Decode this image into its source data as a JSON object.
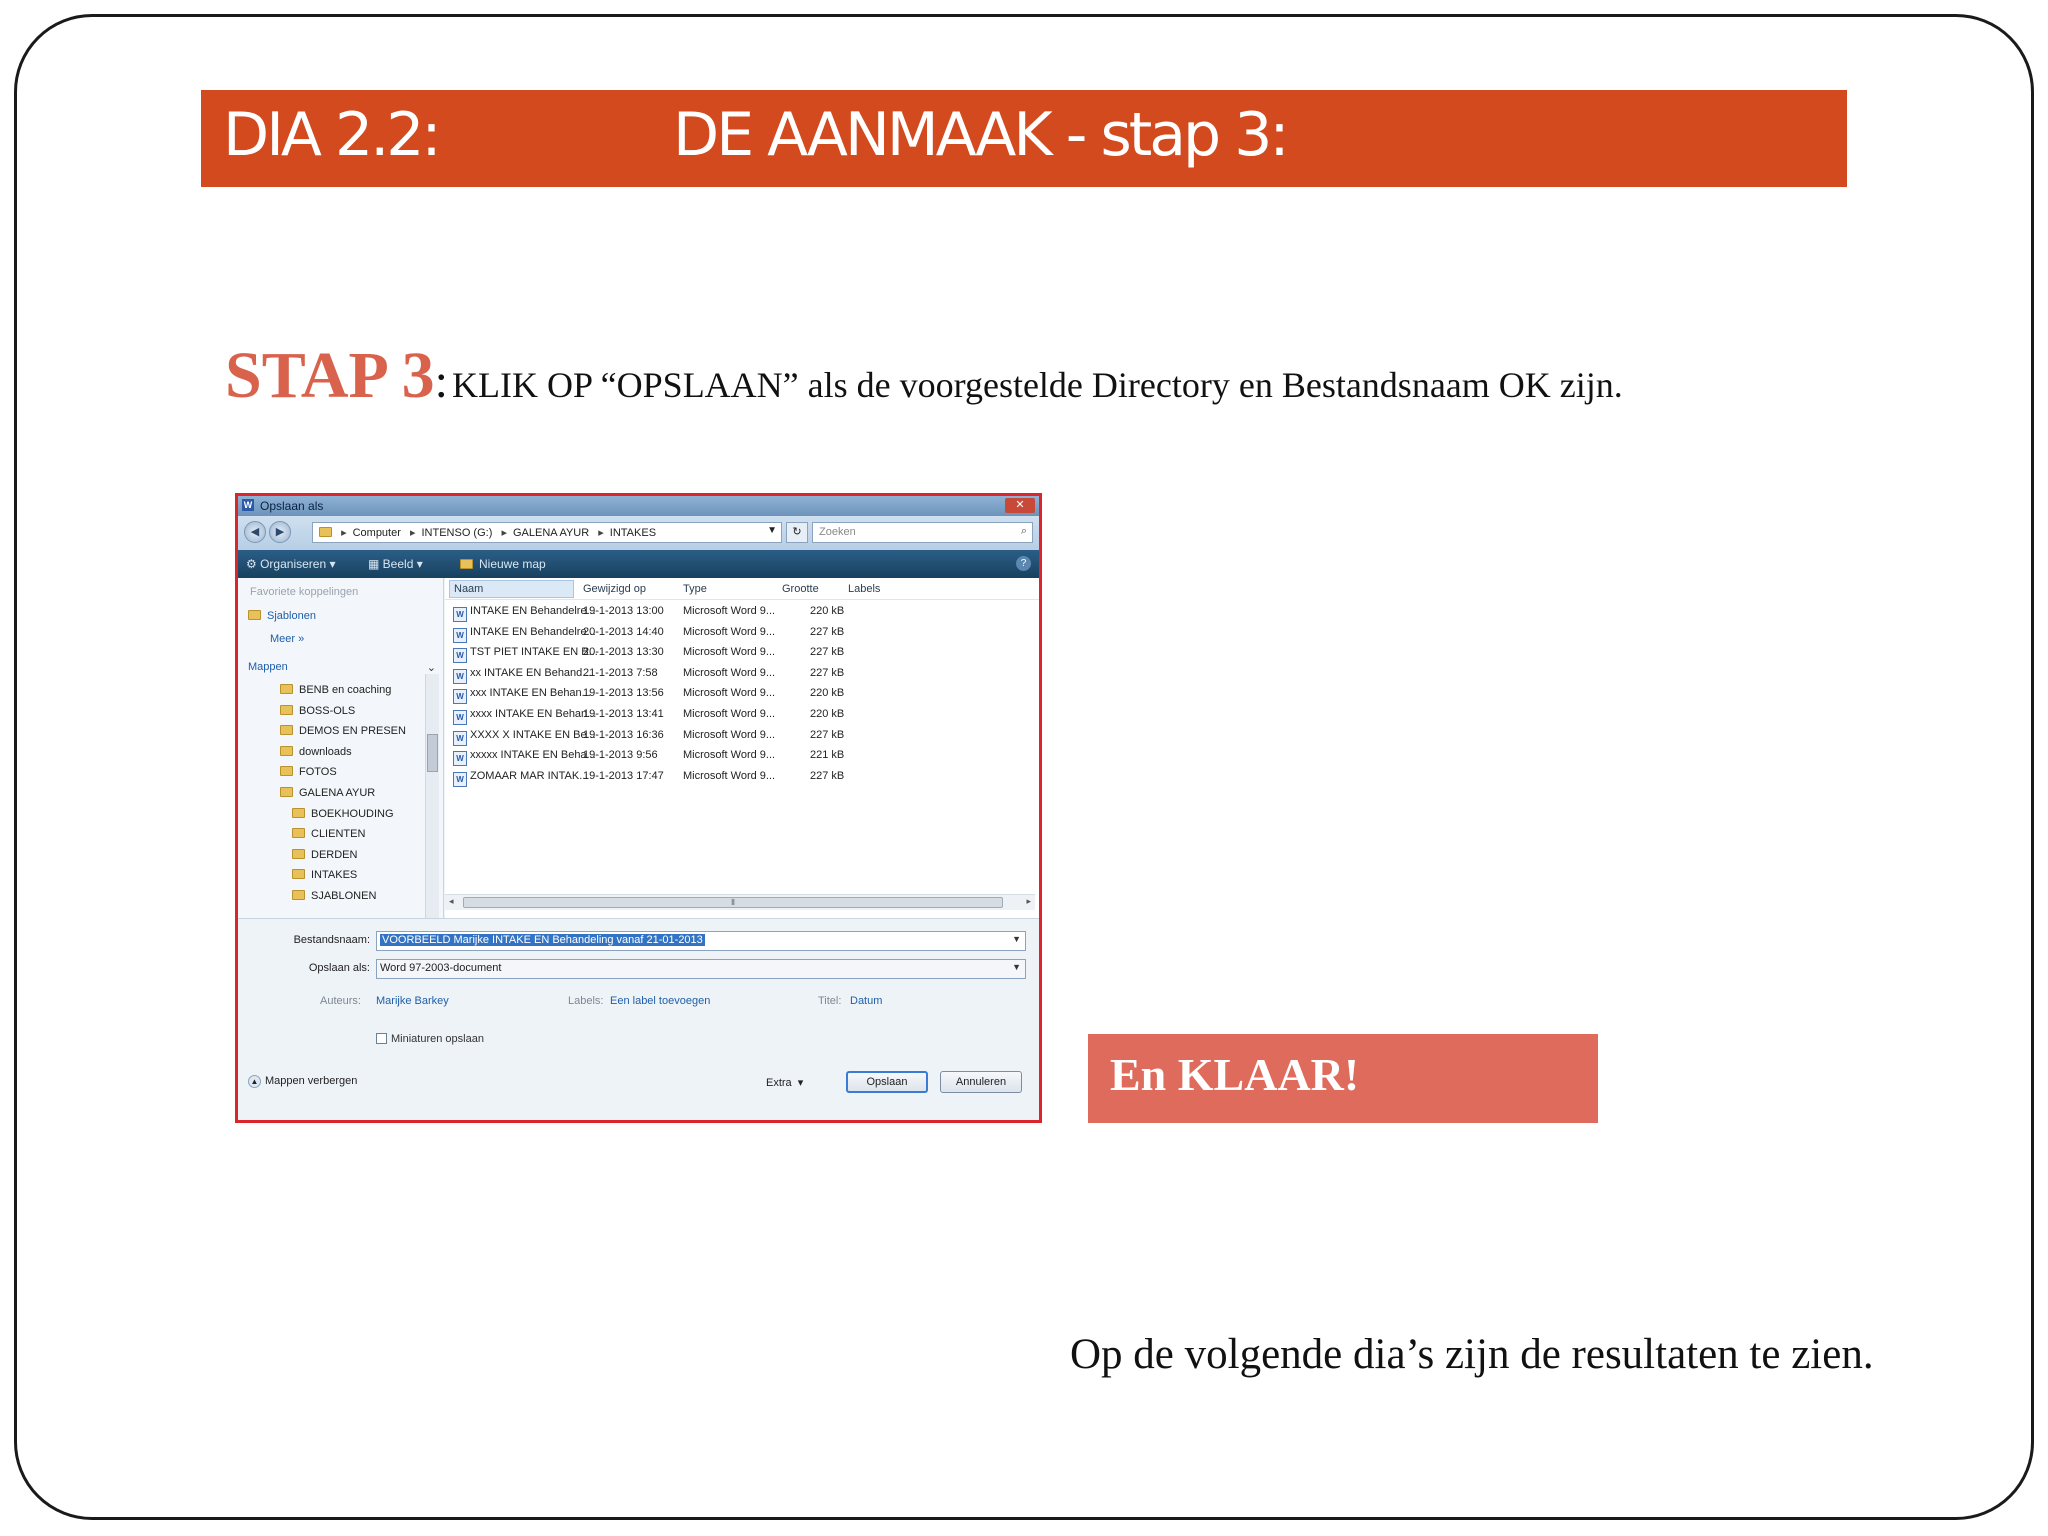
{
  "slide": {
    "title_left": "DIA 2.2:",
    "title_right": "DE AANMAAK - stap 3:",
    "step_label": "STAP 3",
    "step_colon": ":",
    "step_text": "KLIK OP “OPSLAAN” als de voorgestelde Directory en Bestandsnaam OK zijn.",
    "done_badge": "En KLAAR!",
    "footer_note": "Op de volgende dia’s zijn de resultaten te zien.",
    "colors": {
      "title_bar": "#d24a1d",
      "step_label": "#d9624c",
      "badge": "#df6b5d",
      "dialog_border": "#d8262a"
    }
  },
  "dialog": {
    "title": "Opslaan als",
    "address": {
      "crumbs": [
        "Computer",
        "INTENSO (G:)",
        "GALENA AYUR",
        "INTAKES"
      ],
      "search_placeholder": "Zoeken"
    },
    "toolbar": {
      "organize": "Organiseren ▾",
      "view": "Beeld ▾",
      "new_folder": "Nieuwe map"
    },
    "sidebar": {
      "favorites_header": "Favoriete koppelingen",
      "favorites": [
        "Sjablonen",
        "Meer »"
      ],
      "folders_header": "Mappen",
      "tree": [
        {
          "label": "BENB en coaching",
          "level": 1
        },
        {
          "label": "BOSS-OLS",
          "level": 1
        },
        {
          "label": "DEMOS EN PRESEN",
          "level": 1
        },
        {
          "label": "downloads",
          "level": 1
        },
        {
          "label": "FOTOS",
          "level": 1
        },
        {
          "label": "GALENA AYUR",
          "level": 1
        },
        {
          "label": "BOEKHOUDING",
          "level": 2
        },
        {
          "label": "CLIENTEN",
          "level": 2
        },
        {
          "label": "DERDEN",
          "level": 2
        },
        {
          "label": "INTAKES",
          "level": 2
        },
        {
          "label": "SJABLONEN",
          "level": 2
        }
      ]
    },
    "columns": [
      "Naam",
      "Gewijzigd op",
      "Type",
      "Grootte",
      "Labels"
    ],
    "files": [
      {
        "name": "INTAKE EN Behandelre...",
        "date": "19-1-2013 13:00",
        "type": "Microsoft Word 9...",
        "size": "220 kB"
      },
      {
        "name": "INTAKE EN Behandelre...",
        "date": "20-1-2013 14:40",
        "type": "Microsoft Word 9...",
        "size": "227 kB"
      },
      {
        "name": "TST PIET INTAKE EN B...",
        "date": "20-1-2013 13:30",
        "type": "Microsoft Word 9...",
        "size": "227 kB"
      },
      {
        "name": "xx INTAKE EN Behand...",
        "date": "21-1-2013 7:58",
        "type": "Microsoft Word 9...",
        "size": "227 kB"
      },
      {
        "name": "xxx INTAKE EN Behan...",
        "date": "19-1-2013 13:56",
        "type": "Microsoft Word 9...",
        "size": "220 kB"
      },
      {
        "name": "xxxx INTAKE EN Behan...",
        "date": "19-1-2013 13:41",
        "type": "Microsoft Word 9...",
        "size": "220 kB"
      },
      {
        "name": "XXXX X INTAKE EN Be...",
        "date": "19-1-2013 16:36",
        "type": "Microsoft Word 9...",
        "size": "227 kB"
      },
      {
        "name": "xxxxx INTAKE EN Beha...",
        "date": "19-1-2013 9:56",
        "type": "Microsoft Word 9...",
        "size": "221 kB"
      },
      {
        "name": "ZOMAAR MAR INTAK...",
        "date": "19-1-2013 17:47",
        "type": "Microsoft Word 9...",
        "size": "227 kB"
      }
    ],
    "form": {
      "filename_label": "Bestandsnaam:",
      "filename_value": "VOORBEELD Marijke INTAKE EN Behandeling vanaf 21-01-2013",
      "filetype_label": "Opslaan als:",
      "filetype_value": "Word 97-2003-document",
      "author_label": "Auteurs:",
      "author_value": "Marijke Barkey",
      "labels_label": "Labels:",
      "labels_value": "Een label toevoegen",
      "titel_label": "Titel:",
      "titel_value": "Datum",
      "thumbnails_label": "Miniaturen opslaan",
      "hide_folders": "Mappen verbergen",
      "extra": "Extra",
      "save_button": "Opslaan",
      "cancel_button": "Annuleren"
    }
  }
}
